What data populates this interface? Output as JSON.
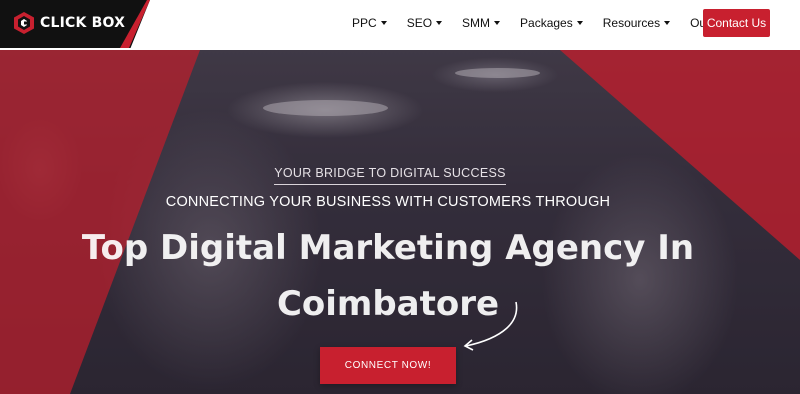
{
  "brand": {
    "name": "CLICK BOX",
    "logo_color": "#c8202f"
  },
  "nav": {
    "items": [
      {
        "label": "PPC",
        "dropdown": true
      },
      {
        "label": "SEO",
        "dropdown": true
      },
      {
        "label": "SMM",
        "dropdown": true
      },
      {
        "label": "Packages",
        "dropdown": true
      },
      {
        "label": "Resources",
        "dropdown": true
      },
      {
        "label": "Our Works",
        "dropdown": false
      }
    ],
    "contact_label": "Contact Us"
  },
  "hero": {
    "tagline": "YOUR BRIDGE TO DIGITAL SUCCESS",
    "subhead": "CONNECTING YOUR BUSINESS WITH CUSTOMERS THROUGH",
    "headline_line1": "Top Digital Marketing Agency In",
    "headline_line2": "Coimbatore",
    "cta_label": "CONNECT NOW!"
  },
  "colors": {
    "accent": "#c8202f",
    "header_bg": "#ffffff",
    "logo_bg": "#111111"
  }
}
